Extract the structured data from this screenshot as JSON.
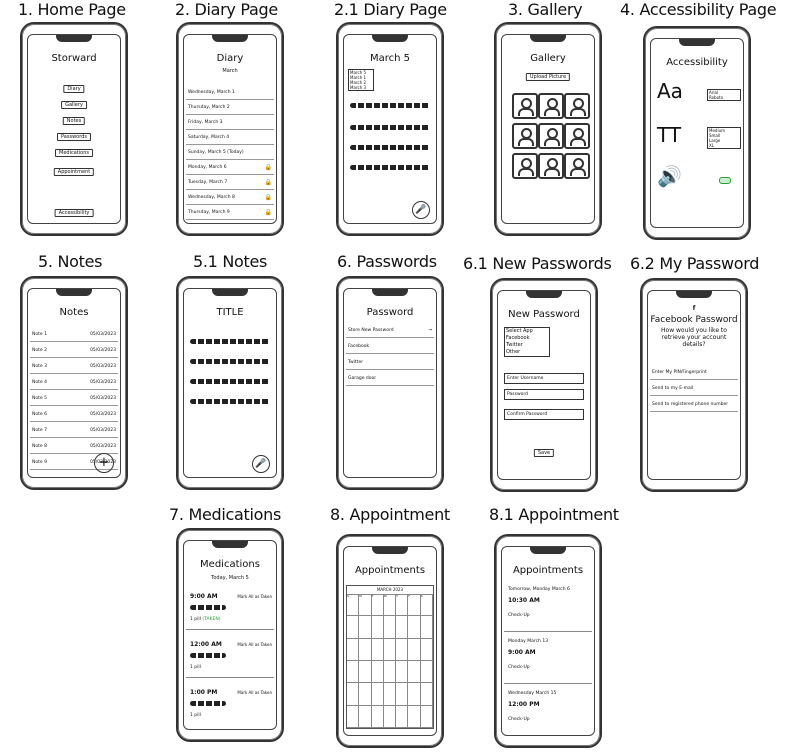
{
  "labels": {
    "home": "1. Home Page",
    "diary": "2. Diary Page",
    "diary21": "2.1 Diary Page",
    "gallery": "3. Gallery",
    "access": "4. Accessibility Page",
    "notes": "5. Notes",
    "notes51": "5.1 Notes",
    "passwords": "6. Passwords",
    "newpass": "6.1  New Passwords",
    "mypass": "6.2 My Password",
    "meds": "7. Medications",
    "appt": "8. Appointment",
    "appt81": "8.1 Appointment"
  },
  "home": {
    "title": "Storward",
    "buttons": [
      "Diary",
      "Gallery",
      "Notes",
      "Passwords",
      "Medications",
      "Appointment"
    ],
    "access": "Accessibility"
  },
  "diary": {
    "title": "Diary",
    "month": "March",
    "days": [
      "Wednesday, March 1",
      "Thursday, March 2",
      "Friday, March 3",
      "Saturday, March 4",
      "Sunday, March 5 (Today)",
      "Monday, March 6",
      "Tuesday, March 7",
      "Wednesday, March 8",
      "Thursday, March 9"
    ]
  },
  "diary21": {
    "title": "March 5",
    "dropdown": [
      "March 5",
      "March 1",
      "March 2",
      "March 3"
    ]
  },
  "gallery": {
    "title": "Gallery",
    "upload": "Upload Picture"
  },
  "access": {
    "title": "Accessibility",
    "font_icon": "Aa",
    "size_icon": "TT",
    "fonts": [
      "Arial",
      "Roboto"
    ],
    "sizes": [
      "Medium",
      "Small",
      "Large",
      "XL"
    ]
  },
  "notes": {
    "title": "Notes",
    "items": [
      {
        "name": "Note 1",
        "date": "05/03/2023"
      },
      {
        "name": "Note 2",
        "date": "05/03/2023"
      },
      {
        "name": "Note 3",
        "date": "05/03/2023"
      },
      {
        "name": "Note 4",
        "date": "05/03/2023"
      },
      {
        "name": "Note 5",
        "date": "05/03/2023"
      },
      {
        "name": "Note 6",
        "date": "05/03/2023"
      },
      {
        "name": "Note 7",
        "date": "05/03/2023"
      },
      {
        "name": "Note 8",
        "date": "05/03/2023"
      },
      {
        "name": "Note 9",
        "date": "05/03/2023"
      }
    ]
  },
  "notes51": {
    "title": "TITLE"
  },
  "passwords": {
    "title": "Password",
    "store": "Store New Password",
    "items": [
      "Facebook",
      "Twitter",
      "Garage door"
    ]
  },
  "newpass": {
    "title": "New Password",
    "select": "Select App",
    "options": [
      "Facebook",
      "Twitter",
      "Other"
    ],
    "username": "Enter Username",
    "password": "Password",
    "confirm": "Confirm Password",
    "save": "Save"
  },
  "mypass": {
    "title": "Facebook Password",
    "question": "How would you like to retrieve your account details?",
    "opts": [
      "Enter My PIN/Fingerprint",
      "Send to my E-mail",
      "Send to registered phone number"
    ]
  },
  "meds": {
    "title": "Medications",
    "date": "Today, March 5",
    "mark": "Mark All as Taken",
    "slots": [
      {
        "time": "9:00 AM",
        "pill": "1 pill",
        "taken": "(TAKEN)"
      },
      {
        "time": "12:00 AM",
        "pill": "1 pill",
        "taken": ""
      },
      {
        "time": "1:00 PM",
        "pill": "1 pill",
        "taken": ""
      }
    ]
  },
  "appt": {
    "title": "Appointments",
    "month": "MARCH 2023",
    "days": [
      "S",
      "M",
      "T",
      "W",
      "T",
      "F",
      "S"
    ]
  },
  "appt81": {
    "title": "Appointments",
    "items": [
      {
        "date": "Tomorrow, Monday March 6",
        "time": "10:30 AM",
        "what": "Check-Up"
      },
      {
        "date": "Monday March 13",
        "time": "9:00 AM",
        "what": "Check-Up"
      },
      {
        "date": "Wednesday March 15",
        "time": "12:00 PM",
        "what": "Check-Up"
      }
    ]
  }
}
